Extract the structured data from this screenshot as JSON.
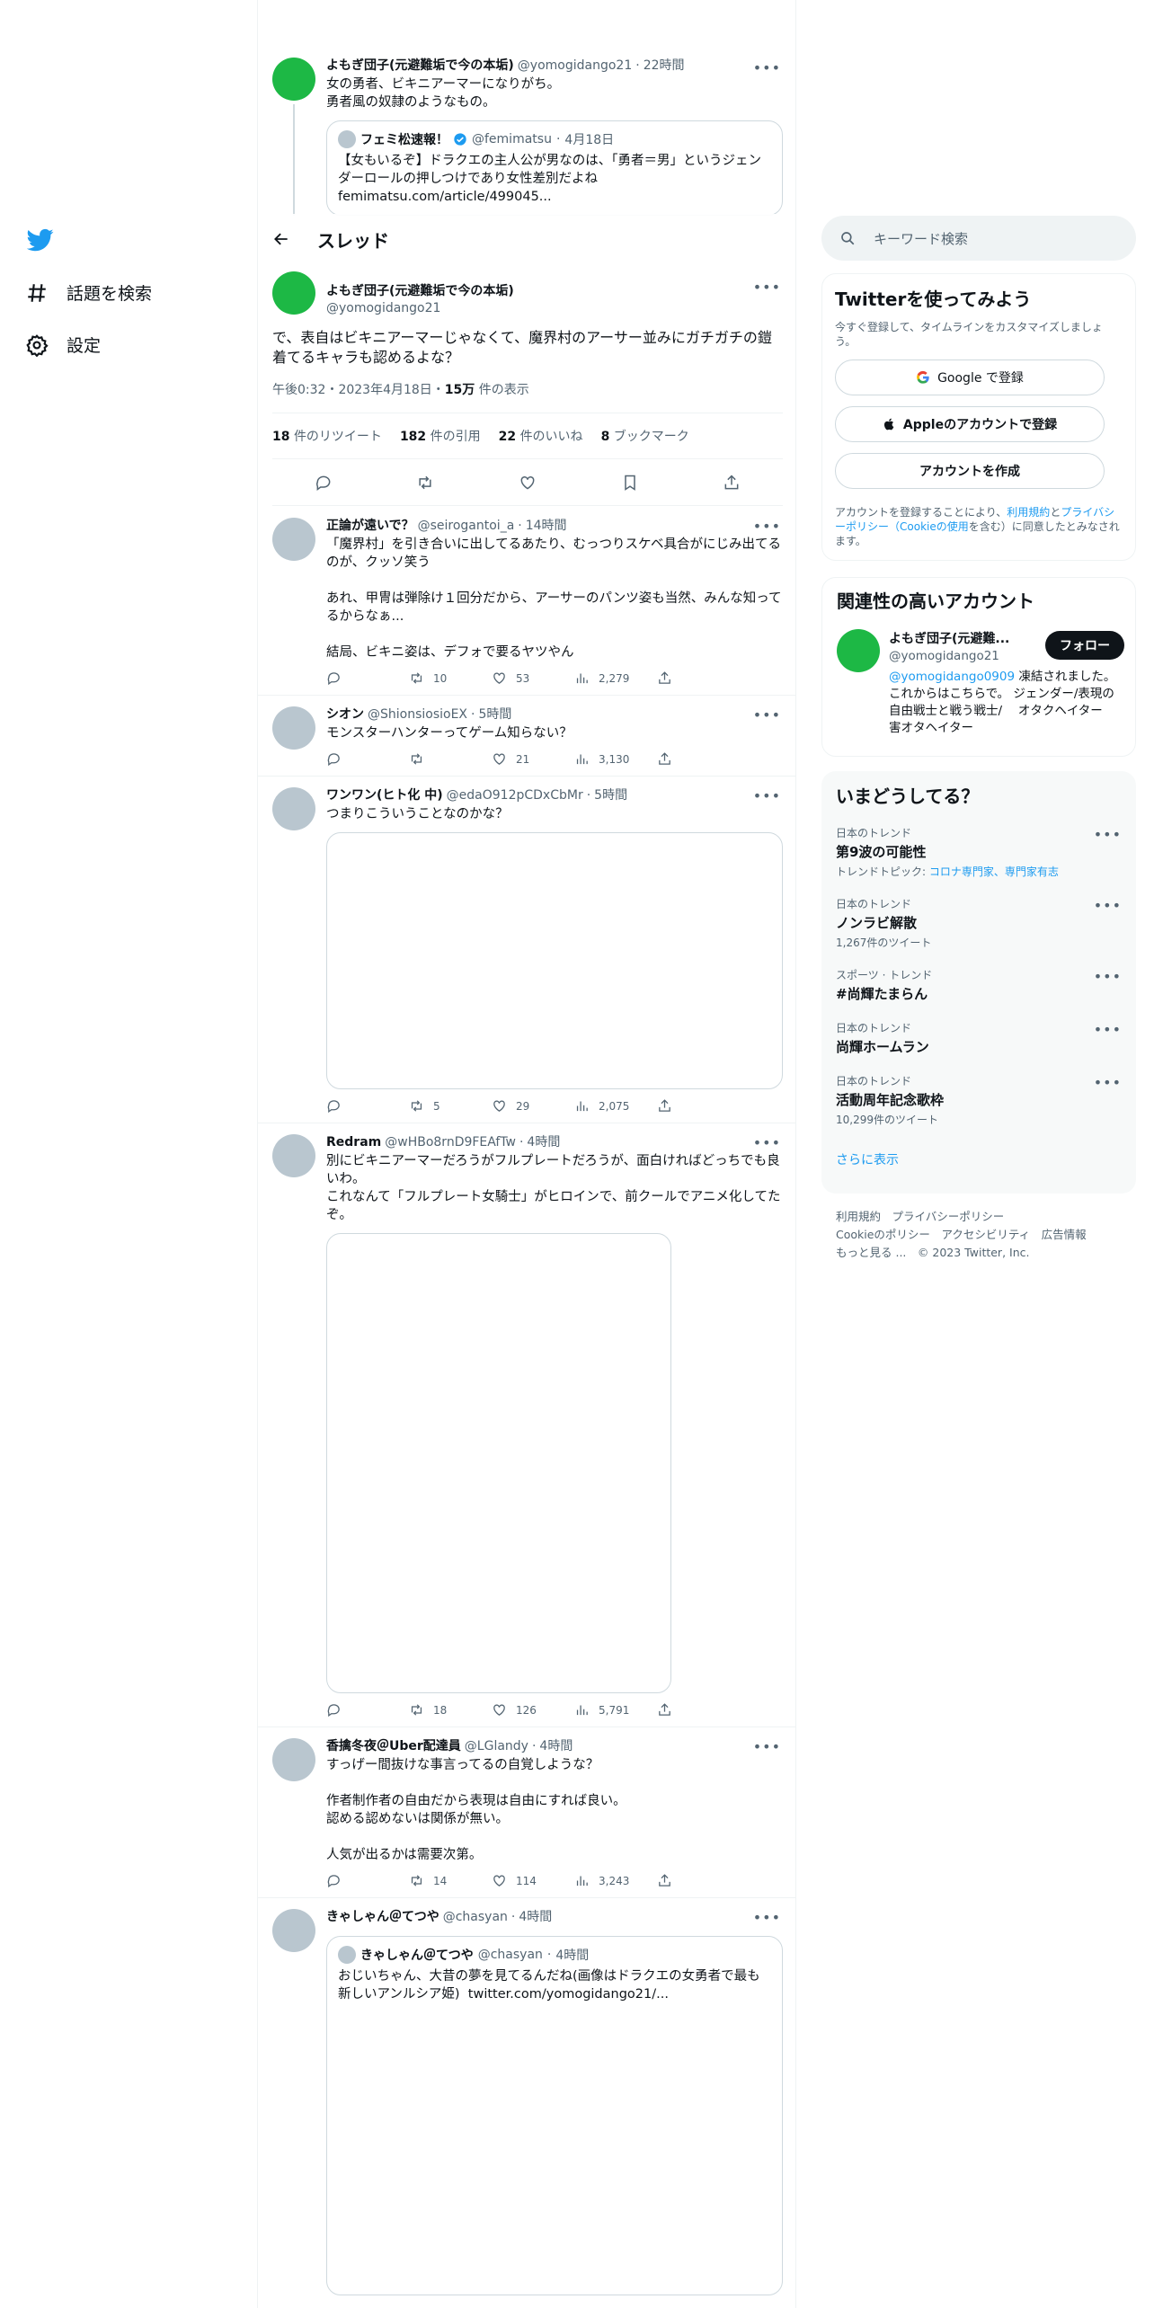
{
  "nav": {
    "items": [
      {
        "label": "話題を検索",
        "icon": "hash-icon"
      },
      {
        "label": "設定",
        "icon": "gear-icon"
      }
    ]
  },
  "header": {
    "title": "スレッド"
  },
  "context": {
    "name": "よもぎ団子(元避難垢で今の本垢)",
    "handle": "@yomogidango21",
    "time": "22時間",
    "text": "女の勇者、ビキニアーマーになりがち。\n勇者風の奴隷のようなもの。",
    "quote": {
      "name": "フェミ松速報！",
      "handle": "@femimatsu",
      "time": "4月18日",
      "text": "【女もいるぞ】ドラクエの主人公が男なのは、「勇者＝男」というジェンダーロールの押しつけであり女性差別だよね\nfemimatsu.com/article/499045..."
    }
  },
  "main": {
    "name": "よもぎ団子(元避難垢で今の本垢)",
    "handle": "@yomogidango21",
    "text": "で、表自はビキニアーマーじゃなくて、魔界村のアーサー並みにガチガチの鎧着てるキャラも認めるよな？",
    "time": "午後0:32・2023年4月18日・",
    "views": "15万",
    "views_label": "件の表示",
    "stats": [
      {
        "num": "18",
        "label": "件のリツイート"
      },
      {
        "num": "182",
        "label": "件の引用"
      },
      {
        "num": "22",
        "label": "件のいいね"
      },
      {
        "num": "8",
        "label": "ブックマーク"
      }
    ]
  },
  "replies": [
    {
      "name": "正論が遠いで？",
      "handle": "@seirogantoi_a",
      "time": "14時間",
      "text": "「魔界村」を引き合いに出してるあたり、むっつりスケベ具合がにじみ出てるのが、クッソ笑う\n\nあれ、甲冑は弾除け１回分だから、アーサーのパンツ姿も当然、みんな知ってるからなぁ...\n\n結局、ビキニ姿は、デフォで要るヤツやん",
      "rt": "10",
      "like": "53",
      "views": "2,279"
    },
    {
      "name": "シオン",
      "handle": "@ShionsiosioEX",
      "time": "5時間",
      "text": "モンスターハンターってゲーム知らない？",
      "rt": "",
      "like": "21",
      "views": "3,130"
    },
    {
      "name": "ワンワン(ヒト化 中)",
      "handle": "@edaO912pCDxCbMr",
      "time": "5時間",
      "text": "つまりこういうことなのかな？",
      "rt": "5",
      "like": "29",
      "views": "2,075"
    },
    {
      "name": "Redram",
      "handle": "@wHBo8rnD9FEAfTw",
      "time": "4時間",
      "text": "別にビキニアーマーだろうがフルプレートだろうが、面白ければどっちでも良いわ。\nこれなんて「フルプレート女騎士」がヒロインで、前クールでアニメ化してたぞ。",
      "rt": "18",
      "like": "126",
      "views": "5,791"
    },
    {
      "name": "香擒冬夜＠Uber配達員",
      "handle": "@LGlandy",
      "time": "4時間",
      "text": "すっげー間抜けな事言ってるの自覚しような？\n\n作者制作者の自由だから表現は自由にすれば良い。\n認める認めないは関係が無い。\n\n人気が出るかは需要次第。",
      "rt": "14",
      "like": "114",
      "views": "3,243"
    },
    {
      "name": "きゃしゃん＠てつや",
      "handle": "@chasyan",
      "time": "4時間",
      "quote": {
        "name": "きゃしゃん＠てつや",
        "handle": "@chasyan",
        "time": "4時間",
        "text": "おじいちゃん、大昔の夢を見てるんだね(画像はドラクエの女勇者で最も新しいアンルシア姫)  twitter.com/yomogidango21/..."
      }
    }
  ],
  "right": {
    "search_placeholder": "キーワード検索",
    "signup": {
      "title": "Twitterを使ってみよう",
      "desc": "今すぐ登録して、タイムラインをカスタマイズしましょう。",
      "google": "Google で登録",
      "apple": "Appleのアカウントで登録",
      "create": "アカウントを作成",
      "terms1": "アカウントを登録することにより、",
      "terms_link1": "利用規約",
      "terms2": "と",
      "terms_link2": "プライバシーポリシー（Cookieの使用",
      "terms3": "を含む）に同意したとみなされます。"
    },
    "related": {
      "title": "関連性の高いアカウント",
      "name": "よもぎ団子(元避難...",
      "handle": "@yomogidango21",
      "follow": "フォロー",
      "bio_link": "@yomogidango0909",
      "bio": " 凍結されました。 これからはこちらで。 ジェンダー/表現の自由戦士と戦う戦士/　 オタクヘイター　 害オタヘイター"
    },
    "trends": {
      "title": "いまどうしてる？",
      "items": [
        {
          "meta": "日本のトレンド",
          "name": "第9波の可能性",
          "sub": "トレンドトピック: ",
          "sub_link": "コロナ専門家、専門家有志"
        },
        {
          "meta": "日本のトレンド",
          "name": "ノンラビ解散",
          "sub": "1,267件のツイート",
          "sub_link": ""
        },
        {
          "meta": "スポーツ · トレンド",
          "name": "#尚輝たまらん",
          "sub": "",
          "sub_link": ""
        },
        {
          "meta": "日本のトレンド",
          "name": "尚輝ホームラン",
          "sub": "",
          "sub_link": ""
        },
        {
          "meta": "日本のトレンド",
          "name": "活動周年記念歌枠",
          "sub": "10,299件のツイート",
          "sub_link": ""
        }
      ],
      "more": "さらに表示"
    },
    "footer": {
      "line1": [
        "利用規約",
        "プライバシーポリシー"
      ],
      "line2": [
        "Cookieのポリシー",
        "アクセシビリティ",
        "広告情報"
      ],
      "line3": [
        "もっと見る ...",
        "© 2023 Twitter, Inc."
      ]
    }
  },
  "colors": {
    "accent": "#1d9bf0",
    "avatar_green": "#1db845"
  }
}
